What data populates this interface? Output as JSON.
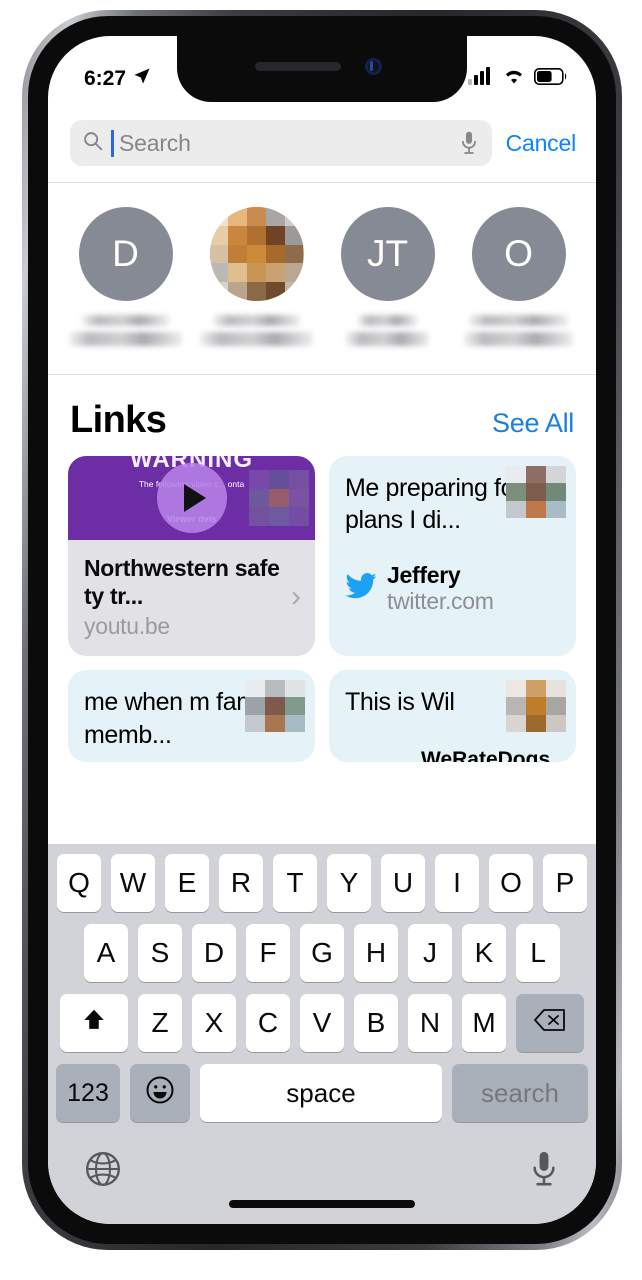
{
  "status_bar": {
    "time": "6:27",
    "location_icon": "location-arrow-icon",
    "cellular_icon": "cellular-signal-icon",
    "wifi_icon": "wifi-icon",
    "battery_icon": "battery-icon",
    "signal_bars_filled": 3,
    "signal_bars_total": 4,
    "battery_level_percent": 55
  },
  "search": {
    "placeholder": "Search",
    "value": "",
    "search_icon": "search-icon",
    "mic_icon": "microphone-icon",
    "cancel_label": "Cancel"
  },
  "contacts": [
    {
      "initials": "D",
      "type": "initials",
      "name_hidden": true
    },
    {
      "initials": "",
      "type": "photo",
      "name_hidden": true
    },
    {
      "initials": "JT",
      "type": "initials",
      "name_hidden": true
    },
    {
      "initials": "O",
      "type": "initials",
      "name_hidden": true
    }
  ],
  "links": {
    "title": "Links",
    "see_all_label": "See All",
    "cards": [
      {
        "kind": "youtube",
        "thumb_warning": "WARNING",
        "thumb_line1": "The following video c...           onta",
        "thumb_line2": "prepare someon                   acti",
        "thumb_line3": "Viewer                            dvis",
        "title": "Northwestern safety tr...",
        "domain": "youtu.be",
        "play_icon": "play-button-icon",
        "chevron_icon": "chevron-right-icon"
      },
      {
        "kind": "twitter",
        "text": "Me preparing for plans I di...",
        "user": "Jeffery",
        "domain": "twitter.com",
        "icon": "twitter-bird-icon"
      }
    ],
    "cards_partial": [
      {
        "kind": "twitter",
        "text": "me when m family memb...",
        "sub": ""
      },
      {
        "kind": "twitter",
        "text": "This is Wil",
        "sub": "WeRateDogs"
      }
    ]
  },
  "keyboard": {
    "row1": [
      "Q",
      "W",
      "E",
      "R",
      "T",
      "Y",
      "U",
      "I",
      "O",
      "P"
    ],
    "row2": [
      "A",
      "S",
      "D",
      "F",
      "G",
      "H",
      "J",
      "K",
      "L"
    ],
    "row3": [
      "Z",
      "X",
      "C",
      "V",
      "B",
      "N",
      "M"
    ],
    "shift_icon": "shift-arrow-icon",
    "backspace_icon": "backspace-icon",
    "numeric_label": "123",
    "emoji_icon": "emoji-smiley-icon",
    "space_label": "space",
    "return_label": "search",
    "globe_icon": "globe-icon",
    "dictation_icon": "microphone-icon"
  },
  "colors": {
    "accent_blue": "#0a84ff",
    "link_blue": "#1a7fe0",
    "twitter_card_bg": "#e5f2f8",
    "youtube_thumb_purple": "#6d2ea5",
    "avatar_gray": "#868a94",
    "keyboard_bg": "#d1d3d9"
  }
}
